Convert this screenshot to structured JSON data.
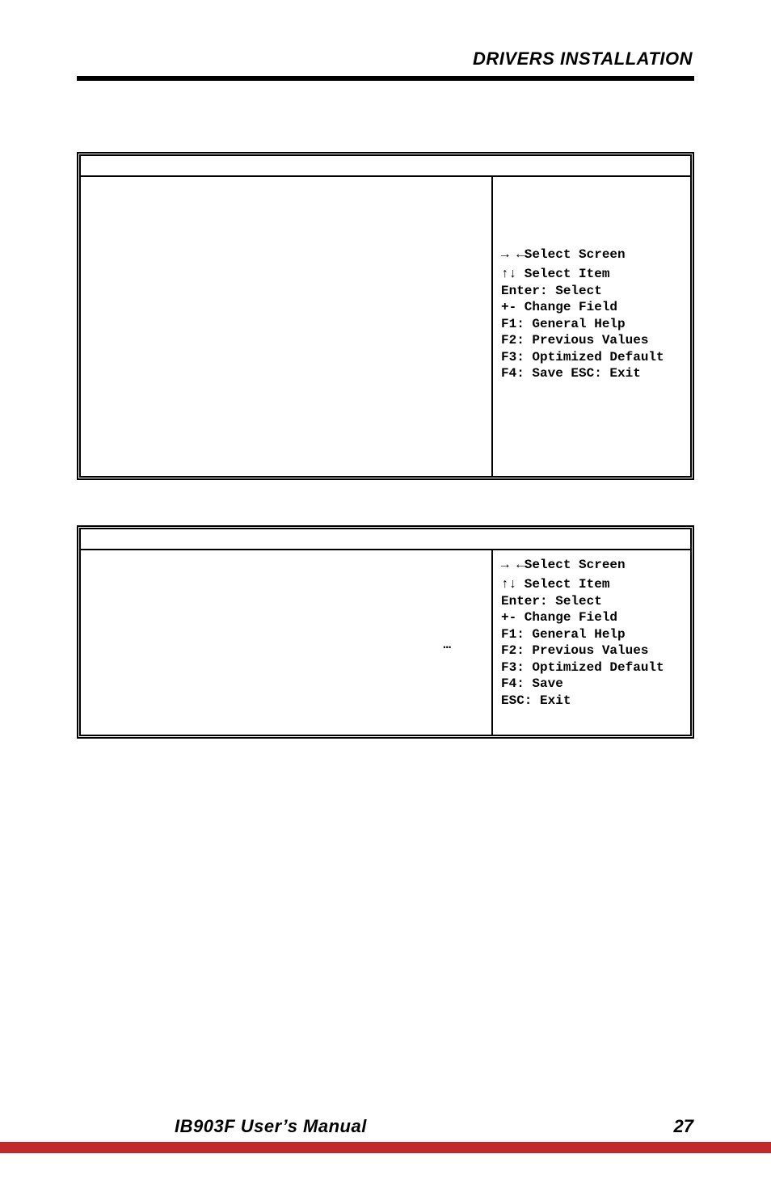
{
  "header": {
    "title": "DRIVERS INSTALLATION"
  },
  "box1": {
    "help": {
      "select_screen": "→ ←Select Screen",
      "select_item": "↑↓ Select Item",
      "enter": "Enter: Select",
      "change": "+-  Change Field",
      "f1": "F1: General Help",
      "f2": "F2: Previous Values",
      "f3": "F3: Optimized Default",
      "f4": "F4: Save  ESC: Exit"
    }
  },
  "box2": {
    "ellipsis": "…",
    "help": {
      "select_screen": "→ ←Select Screen",
      "select_item": "↑↓ Select Item",
      "enter": "Enter: Select",
      "change": "+-  Change Field",
      "f1": "F1: General Help",
      "f2": "F2: Previous Values",
      "f3": "F3: Optimized Default",
      "f4": "F4: Save",
      "esc": "ESC: Exit"
    }
  },
  "footer": {
    "manual": "IB903F User’s Manual",
    "page": "27"
  }
}
